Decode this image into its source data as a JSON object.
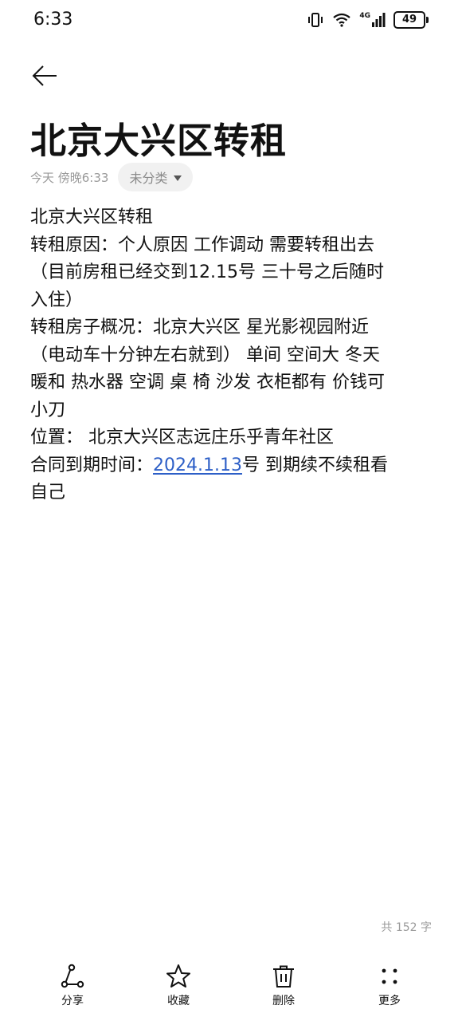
{
  "status_bar": {
    "time": "6:33",
    "battery_level": "49",
    "network_label": "4G"
  },
  "note": {
    "title": "北京大兴区转租",
    "date": "今天 傍晚6:33",
    "category": "未分类",
    "lines": [
      "北京大兴区转租",
      "转租原因：个人原因 工作调动 需要转租出去",
      "（目前房租已经交到12.15号 三十号之后随时",
      "入住）",
      "转租房子概况：北京大兴区 星光影视园附近",
      "（电动车十分钟左右就到） 单间 空间大  冬天",
      "暖和 热水器 空调 桌 椅 沙发 衣柜都有  价钱可",
      "小刀",
      "位置： 北京大兴区志远庄乐乎青年社区"
    ],
    "contract_prefix": "合同到期时间：",
    "contract_date": "2024.1.13",
    "contract_suffix": "号 到期续不续租看",
    "last_line": "自己"
  },
  "word_count": "共 152 字",
  "toolbar": {
    "share_label": "分享",
    "favorite_label": "收藏",
    "delete_label": "删除",
    "more_label": "更多"
  },
  "icons": {
    "back": "back-arrow-icon",
    "share": "share-icon",
    "favorite": "star-icon",
    "delete": "trash-icon",
    "more": "more-dots-icon",
    "dropdown": "caret-down-icon"
  },
  "colors": {
    "link": "#2d5fc7",
    "muted": "#9a9a9a",
    "chip_bg": "#f1f1f1"
  }
}
